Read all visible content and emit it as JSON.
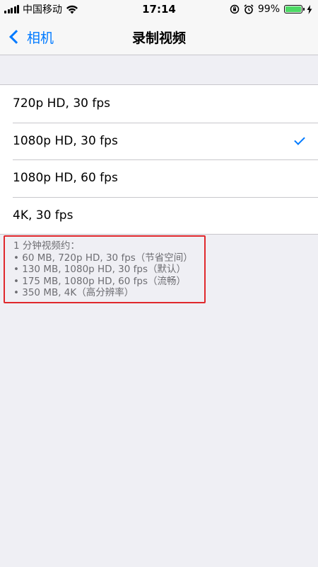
{
  "status_bar": {
    "carrier": "中国移动",
    "time": "17:14",
    "battery_text": "99%",
    "battery_level": 0.99,
    "icons": [
      "signal-icon",
      "wifi-icon",
      "rotation-lock-icon",
      "alarm-icon",
      "battery-icon",
      "charging-icon"
    ]
  },
  "nav": {
    "back_label": "相机",
    "title": "录制视频"
  },
  "options": [
    {
      "label": "720p HD, 30 fps",
      "selected": false
    },
    {
      "label": "1080p HD, 30 fps",
      "selected": true
    },
    {
      "label": "1080p HD, 60 fps",
      "selected": false
    },
    {
      "label": "4K, 30 fps",
      "selected": false
    }
  ],
  "note": {
    "heading": "1 分钟视频约：",
    "items": [
      "• 60 MB, 720p HD, 30 fps（节省空间）",
      "• 130 MB, 1080p HD, 30 fps（默认）",
      "• 175 MB, 1080p HD, 60 fps（流畅）",
      "• 350 MB, 4K（高分辨率）"
    ]
  },
  "colors": {
    "accent": "#007aff",
    "highlight_box": "#e0282c",
    "battery": "#4cd964"
  }
}
